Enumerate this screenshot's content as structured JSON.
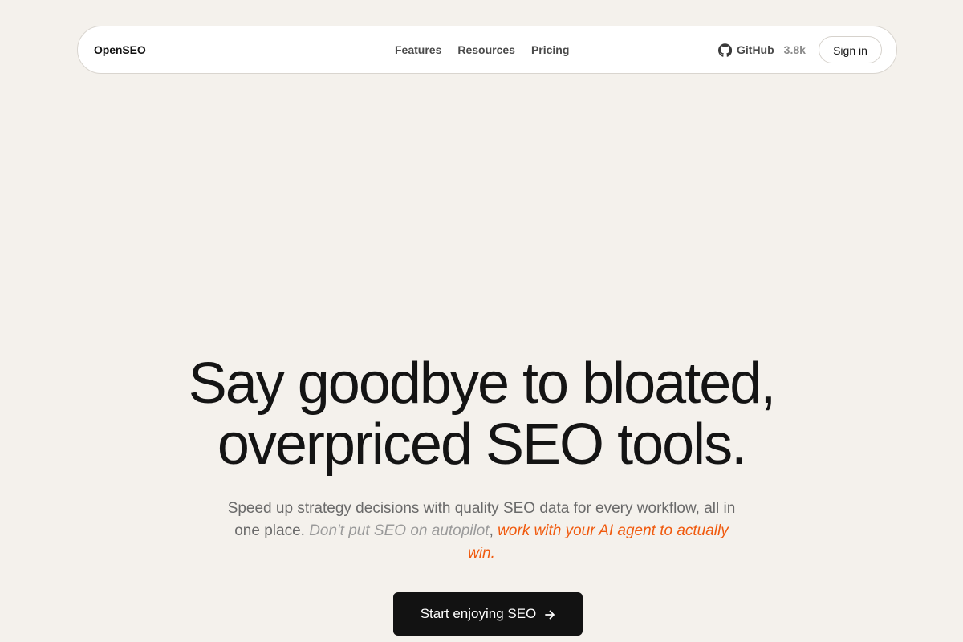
{
  "nav": {
    "brand": "OpenSEO",
    "links": [
      "Features",
      "Resources",
      "Pricing"
    ],
    "github_label": "GitHub",
    "github_stars": "3.8k",
    "signin_label": "Sign in"
  },
  "hero": {
    "headline_line1": "Say goodbye to bloated,",
    "headline_line2": "overpriced SEO tools.",
    "subtext_plain": "Speed up strategy decisions with quality SEO data for every workflow, all in one place.",
    "subtext_muted": "Don't put SEO on autopilot",
    "subtext_comma": ",",
    "subtext_accent": "work with your AI agent to actually win.",
    "cta_label": "Start enjoying SEO"
  },
  "icons": {
    "github": "github-icon",
    "cta": "arrow-right-icon"
  },
  "colors": {
    "background": "#f4f1ec",
    "accent": "#f05a0e",
    "primary": "#121212"
  }
}
